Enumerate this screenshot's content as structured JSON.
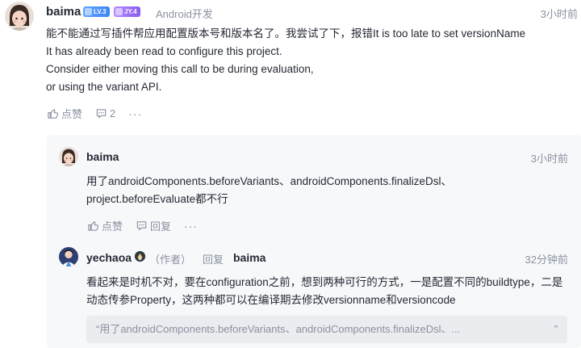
{
  "comment": {
    "user": "baima",
    "badges": {
      "level": "LV.3",
      "jy": "JY.4"
    },
    "position": "Android开发",
    "time": "3小时前",
    "lines": [
      "能不能通过写插件帮应用配置版本号和版本名了。我尝试了下，报错It is too late to set versionName",
      "It has already been read to configure this project.",
      "Consider either moving this call to be during evaluation,",
      "or using the variant API."
    ],
    "like_label": "点赞",
    "comment_count": "2",
    "more": "···"
  },
  "replies": [
    {
      "user": "baima",
      "time": "3小时前",
      "lines": [
        "用了androidComponents.beforeVariants、androidComponents.finalizeDsl、",
        "project.beforeEvaluate都不行"
      ],
      "like_label": "点赞",
      "reply_label": "回复",
      "more": "···"
    },
    {
      "user": "yechaoa",
      "author_tag": "（作者）",
      "reply_word": "回复",
      "reply_to": "baima",
      "time": "32分钟前",
      "lines": [
        "看起来是时机不对，要在configuration之前，想到两种可行的方式，一是配置不同的buildtype，二是",
        "动态传参Property，这两种都可以在编译期去修改versionname和versioncode"
      ],
      "quote": "“用了androidComponents.beforeVariants、androidComponents.finalizeDsl、...",
      "quote_end": "”"
    }
  ],
  "colors": {
    "text": "#252933",
    "muted": "#8a919f",
    "panel": "#f7f8fa",
    "badge_lv": "#3e83f6",
    "badge_jy": "#8a5cf0"
  },
  "icons": [
    "avatar-baima",
    "avatar-yechaoa",
    "thumbs-up-icon",
    "comment-icon",
    "more-icon",
    "vip-icon"
  ]
}
